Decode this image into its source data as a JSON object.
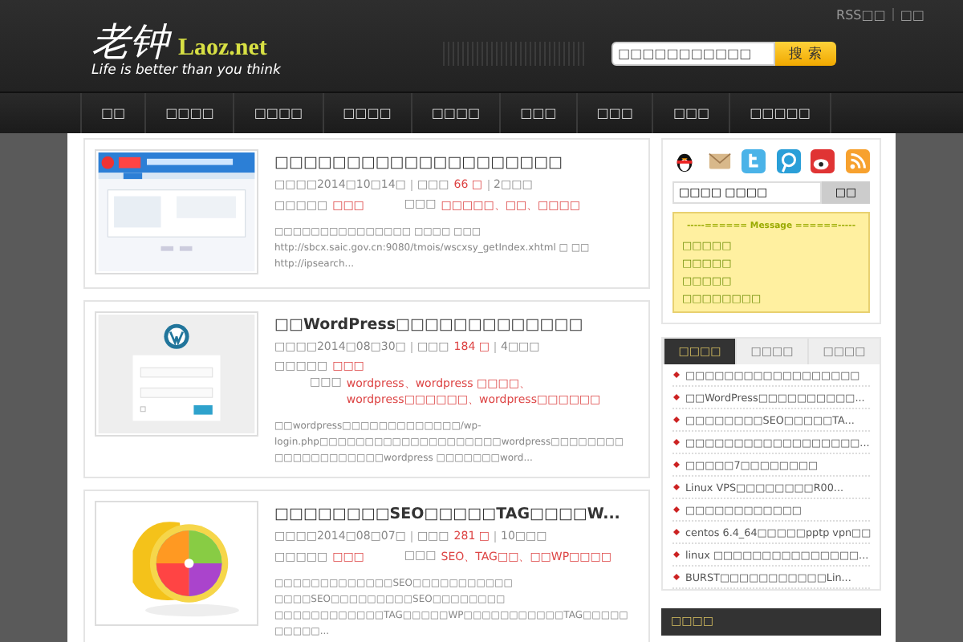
{
  "header": {
    "logo": "老钟",
    "domain": "Laoz.net",
    "tagline": "Life is better than you think",
    "top_links": [
      "RSS□□",
      "□□"
    ],
    "search": {
      "value": "□□□□□□□□□□□",
      "button": "搜 索"
    }
  },
  "nav": {
    "items": [
      "□□",
      "□□□□",
      "□□□□",
      "□□□□",
      "□□□□",
      "□□□",
      "□□□",
      "□□□",
      "□□□□□"
    ]
  },
  "posts": [
    {
      "title": "□□□□□□□□□□□□□□□□□□□□",
      "date": "□□□□2014□10□14□",
      "views_label": "□□□",
      "views": "66 □",
      "comments": "2□□□",
      "category_label": "□□□□□",
      "category": "□□□",
      "tags_label": "□□□",
      "tags": "□□□□□、□□、□□□□",
      "excerpt": "□□□□□□□□□□□□□□□ □□□□ □□□ http://sbcx.saic.gov.cn:9080/tmois/wscxsy_getIndex.xhtml □ □□ http://ipsearch..."
    },
    {
      "title": "□□WordPress□□□□□□□□□□□□□",
      "date": "□□□□2014□08□30□",
      "views_label": "□□□",
      "views": "184 □",
      "comments": "4□□□",
      "category_label": "□□□□□",
      "category": "□□□",
      "tags_label": "□□□",
      "tags": "wordpress、wordpress □□□□、wordpress□□□□□□、wordpress□□□□□□",
      "excerpt": "□□wordpress□□□□□□□□□□□□□/wp-login.php□□□□□□□□□□□□□□□□□□□□wordpress□□□□□□□□□□□□□□□□□□□□wordpress □□□□□□□word..."
    },
    {
      "title": "□□□□□□□□SEO□□□□□TAG□□□□W...",
      "date": "□□□□2014□08□07□",
      "views_label": "□□□",
      "views": "281 □",
      "comments": "10□□□",
      "category_label": "□□□□□",
      "category": "□□□",
      "tags_label": "□□□",
      "tags": "SEO、TAG□□、□□WP□□□□",
      "excerpt": "□□□□□□□□□□□□□SEO□□□□□□□□□□□ □□□□SEO□□□□□□□□□SEO□□□□□□□□ □□□□□□□□□□□□TAG□□□□□WP□□□□□□□□□□□TAG□□□□□□□□□□..."
    }
  ],
  "sidebar": {
    "search": {
      "value": "□□□□ □□□□",
      "button": "□□"
    },
    "message": {
      "heading": "-----====== Message ======-----",
      "lines": [
        "□□□□□",
        "□□□□□",
        "□□□□□",
        "□□□□□□□□"
      ]
    },
    "tabs": [
      {
        "label": "□□□□",
        "selected": true
      },
      {
        "label": "□□□□",
        "selected": false
      },
      {
        "label": "□□□□",
        "selected": false
      }
    ],
    "list": [
      "□□□□□□□□□□□□□□□□□□",
      "□□WordPress□□□□□□□□□□...",
      "□□□□□□□□SEO□□□□□TA...",
      "□□□□□□□□□□□□□□□□□□...",
      "□□□□□7□□□□□□□□",
      "Linux VPS□□□□□□□□R00...",
      "□□□□□□□□□□□□",
      "centos 6.4_64□□□□□pptp vpn□□",
      "linux □□□□□□□□□□□□□□□...",
      "BURST□□□□□□□□□□□Lin..."
    ],
    "widget_title": "□□□□"
  }
}
